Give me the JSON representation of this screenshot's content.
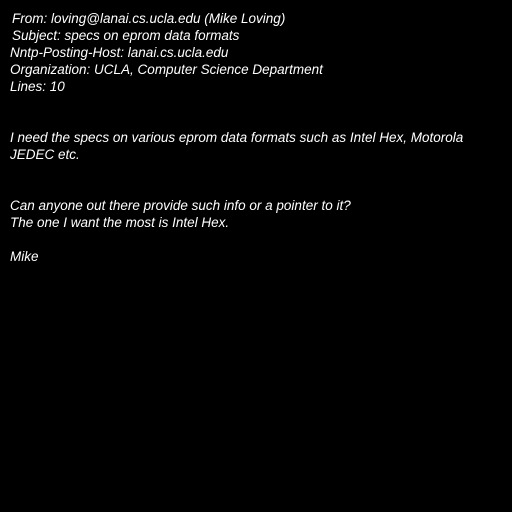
{
  "headers": {
    "from": "From: loving@lanai.cs.ucla.edu (Mike Loving)",
    "subject": "Subject: specs on eprom data formats",
    "nntp_posting_host": "Nntp-Posting-Host: lanai.cs.ucla.edu",
    "organization": "Organization: UCLA, Computer Science Department",
    "lines": "Lines: 10"
  },
  "body": {
    "line1": "I need the specs on various eprom data formats such as Intel Hex, Motorola",
    "line2": "JEDEC etc.",
    "line3": "Can anyone out there provide such info or a pointer to it?",
    "line4": "The one I want the most is Intel Hex.",
    "signature": "Mike"
  },
  "colors": {
    "background": "#000000",
    "text": "#ffffff"
  }
}
